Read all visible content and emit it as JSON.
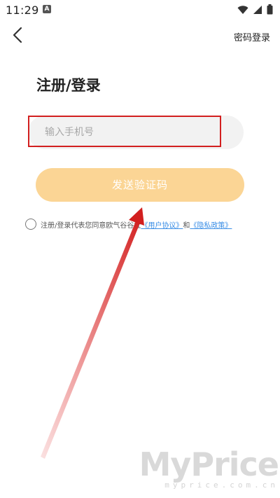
{
  "status_bar": {
    "time": "11:29",
    "app_icon_letter": "A"
  },
  "header": {
    "password_login_label": "密码登录"
  },
  "main": {
    "title": "注册/登录",
    "phone_input_placeholder": "输入手机号",
    "send_code_label": "发送验证码"
  },
  "agreement": {
    "prefix": "注册/登录代表您同意欧气谷谷社",
    "user_agreement": "《用户协议》",
    "conjunction": "和",
    "privacy_policy": "《隐私政策》"
  },
  "watermark": {
    "main": "MyPrice",
    "sub": "myprice.com.cn"
  },
  "colors": {
    "button_bg": "#fbd595",
    "link": "#3a8ee6",
    "highlight": "#d21f1f",
    "input_bg": "#f2f2f2"
  },
  "icons": {
    "back": "chevron-left-icon",
    "wifi": "wifi-icon",
    "signal": "signal-icon",
    "battery": "battery-icon"
  }
}
